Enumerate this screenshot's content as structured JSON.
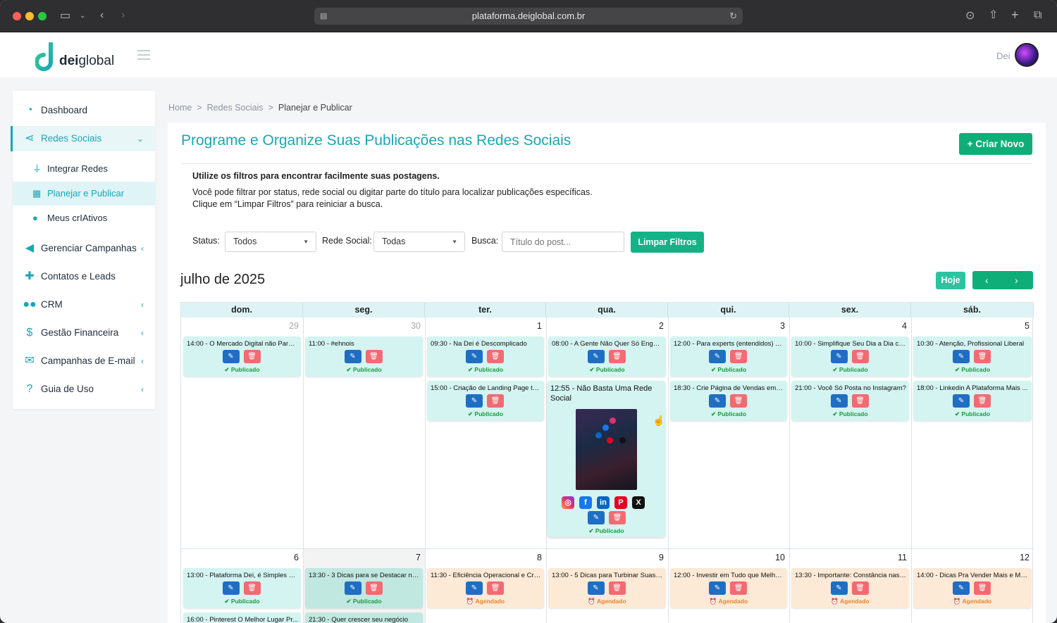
{
  "browser": {
    "url": "plataforma.deiglobal.com.br"
  },
  "brand": {
    "logo_text_bold": "dei",
    "logo_text_light": "global",
    "accent": "#1aa6b7",
    "green": "#0fae79"
  },
  "user": {
    "name": "Dei"
  },
  "sidebar": {
    "items": [
      {
        "label": "Dashboard",
        "icon": "dashboard-icon"
      },
      {
        "label": "Redes Sociais",
        "icon": "share-icon"
      },
      {
        "label": "Gerenciar Campanhas",
        "icon": "megaphone-icon"
      },
      {
        "label": "Contatos e Leads",
        "icon": "user-plus-icon"
      },
      {
        "label": "CRM",
        "icon": "users-icon"
      },
      {
        "label": "Gestão Financeira",
        "icon": "dollar-icon"
      },
      {
        "label": "Campanhas de E-mail",
        "icon": "mail-icon"
      },
      {
        "label": "Guia de Uso",
        "icon": "help-icon"
      }
    ],
    "subitems": [
      {
        "label": "Integrar Redes",
        "icon": "plug-icon"
      },
      {
        "label": "Planejar e Publicar",
        "icon": "calendar-icon"
      },
      {
        "label": "Meus crIAtivos",
        "icon": "lightbulb-icon"
      }
    ]
  },
  "breadcrumb": [
    "Home",
    "Redes Sociais",
    "Planejar e Publicar"
  ],
  "page": {
    "title": "Programe e Organize Suas Publicações nas Redes Sociais",
    "create_button": "+ Criar Novo",
    "info_bold": "Utilize os filtros para encontrar facilmente suas postagens.",
    "info_line1": "Você pode filtrar por status, rede social ou digitar parte do título para localizar publicações específicas.",
    "info_line2": "Clique em “Limpar Filtros” para reiniciar a busca."
  },
  "filters": {
    "status_label": "Status:",
    "status_value": "Todos",
    "network_label": "Rede Social:",
    "network_value": "Todas",
    "search_label": "Busca:",
    "search_placeholder": "Título do post...",
    "clear_button": "Limpar Filtros"
  },
  "calendar": {
    "month": "julho de 2025",
    "today_button": "Hoje",
    "weekdays": [
      "dom.",
      "seg.",
      "ter.",
      "qua.",
      "qui.",
      "sex.",
      "sáb."
    ],
    "week1_days": [
      "29",
      "30",
      "1",
      "2",
      "3",
      "4",
      "5"
    ],
    "week2_days": [
      "6",
      "7",
      "8",
      "9",
      "10",
      "11",
      "12"
    ],
    "status_published": "✔ Publicado",
    "status_scheduled": "⏰ Agendado",
    "week1_row1": [
      {
        "time": "14:00 -",
        "title": "O Mercado Digital não Para ..."
      },
      {
        "time": "11:00 -",
        "title": "#ehnois"
      },
      {
        "time": "09:30 -",
        "title": "Na Dei é Descomplicado"
      },
      {
        "time": "08:00 -",
        "title": "A Gente Não Quer Só Engaj..."
      },
      {
        "time": "12:00 -",
        "title": "Para experts (entendidos) e ..."
      },
      {
        "time": "10:00 -",
        "title": "Simplifique Seu Dia a Dia co..."
      },
      {
        "time": "10:30 -",
        "title": "Atenção, Profissional Liberal"
      }
    ],
    "week1_row2": [
      {
        "time": "15:00 -",
        "title": "Criação de Landing Page te..."
      },
      {
        "time": "18:30 -",
        "title": "Crie Página de Vendas em M..."
      },
      {
        "time": "21:00 -",
        "title": "Você Só Posta no Instagram?"
      },
      {
        "time": "18:00 -",
        "title": "Linkedin A Plataforma Mais ..."
      }
    ],
    "expanded": {
      "time": "12:55 -",
      "title": "Não Basta Uma Rede Social",
      "networks": [
        "instagram",
        "facebook",
        "linkedin",
        "pinterest",
        "x"
      ]
    },
    "week2_row1": [
      {
        "time": "13:00 -",
        "title": "Plataforma Dei, é Simples e ..."
      },
      {
        "time": "13:30 -",
        "title": "3 Dicas para se Destacar nas..."
      },
      {
        "time": "11:30 -",
        "title": "Eficiência Operacional e Cre..."
      },
      {
        "time": "13:00 -",
        "title": "5 Dicas para Turbinar Suas R..."
      },
      {
        "time": "12:00 -",
        "title": "Investir em Tudo que Melho..."
      },
      {
        "time": "13:30 -",
        "title": "Importante: Constância nas ..."
      },
      {
        "time": "14:00 -",
        "title": "Dicas Pra Vender Mais e Mel..."
      }
    ],
    "week2_row2": [
      {
        "time": "16:00 -",
        "title": "Pinterest O Melhor Lugar Pr..."
      },
      {
        "time": "21:30 -",
        "title": "Quer crescer seu negócio"
      }
    ]
  }
}
